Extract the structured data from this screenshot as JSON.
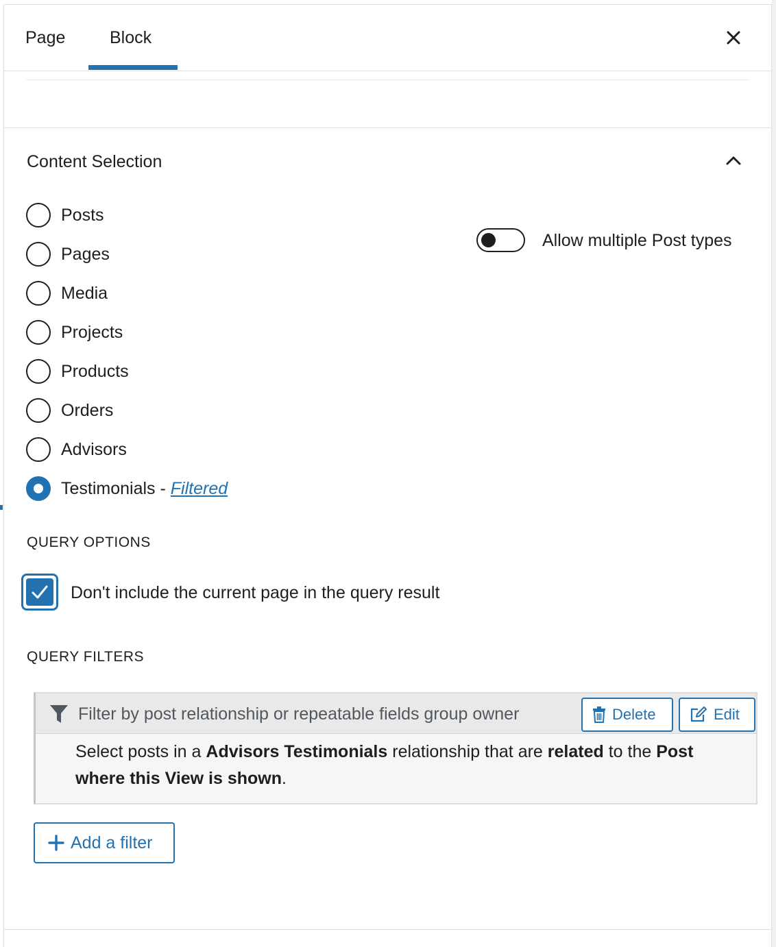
{
  "tabs": {
    "page_label": "Page",
    "block_label": "Block",
    "active": "Block"
  },
  "section": {
    "title": "Content Selection"
  },
  "post_types": [
    {
      "label": "Posts",
      "checked": false
    },
    {
      "label": "Pages",
      "checked": false
    },
    {
      "label": "Media",
      "checked": false
    },
    {
      "label": "Projects",
      "checked": false
    },
    {
      "label": "Products",
      "checked": false
    },
    {
      "label": "Orders",
      "checked": false
    },
    {
      "label": "Advisors",
      "checked": false
    },
    {
      "label": "Testimonials",
      "checked": true,
      "suffix": " - ",
      "link": "Filtered"
    }
  ],
  "toggle": {
    "label": "Allow multiple Post types",
    "on": false
  },
  "query_options": {
    "heading": "QUERY OPTIONS",
    "exclude_current": {
      "label": "Don't include the current page in the query result",
      "checked": true
    }
  },
  "query_filters": {
    "heading": "QUERY FILTERS",
    "filter": {
      "title": "Filter by post relationship or repeatable fields group owner",
      "delete_label": "Delete",
      "edit_label": "Edit",
      "desc": {
        "p1": "Select posts in a ",
        "b1": "Advisors Testimonials",
        "p2": " relationship that are ",
        "b2": "related",
        "p3": " to the ",
        "b3": "Post where this View is shown",
        "p4": "."
      }
    },
    "add_label": "Add a filter"
  },
  "colors": {
    "accent": "#2271b1",
    "text": "#1e1e1e",
    "muted": "#50575e"
  }
}
